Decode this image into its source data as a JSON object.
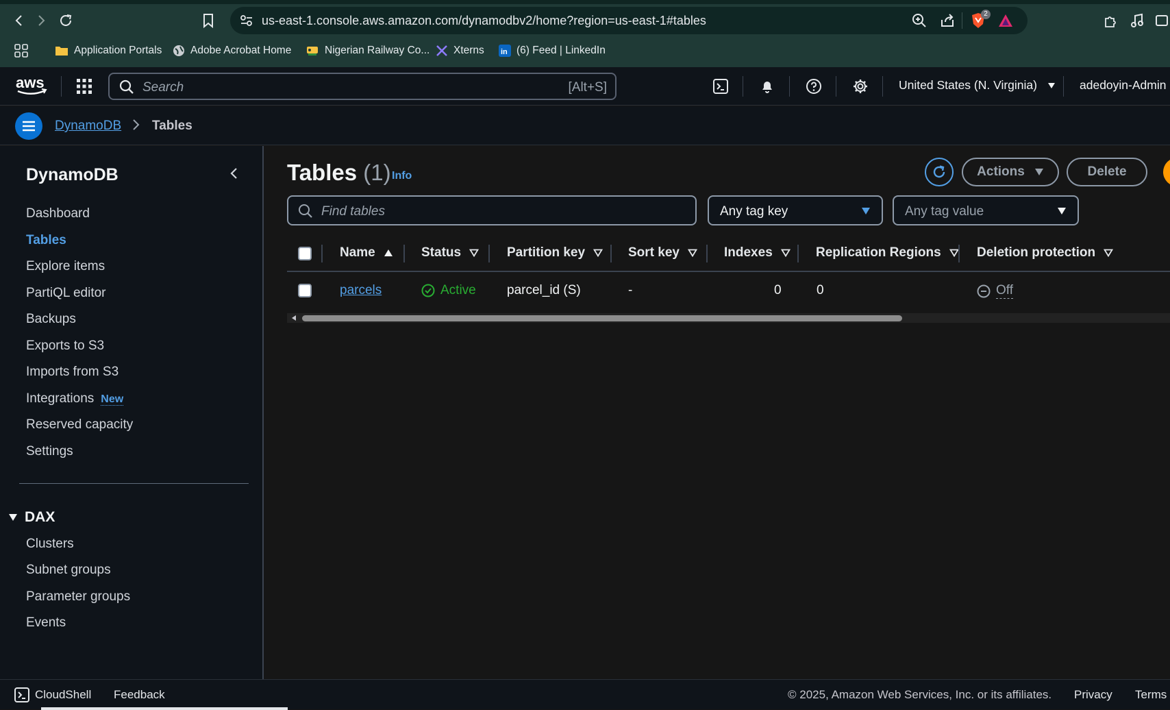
{
  "browser": {
    "url": "us-east-1.console.aws.amazon.com/dynamodbv2/home?region=us-east-1#tables",
    "shield_badge": "2",
    "bookmarks": [
      {
        "label": "Application Portals",
        "icon": "folder-icon"
      },
      {
        "label": "Adobe Acrobat Home",
        "icon": "globe-icon"
      },
      {
        "label": "Nigerian Railway Co...",
        "icon": "railway-logo-icon"
      },
      {
        "label": "Xterns",
        "icon": "x-logo-icon"
      },
      {
        "label": "(6) Feed | LinkedIn",
        "icon": "linkedin-icon"
      }
    ]
  },
  "header": {
    "logo": "aws",
    "search_placeholder": "Search",
    "search_shortcut": "[Alt+S]",
    "region": "United States (N. Virginia)",
    "user": "adedoyin-Admin"
  },
  "breadcrumb": {
    "service": "DynamoDB",
    "current": "Tables"
  },
  "sidebar": {
    "title": "DynamoDB",
    "items": [
      {
        "label": "Dashboard"
      },
      {
        "label": "Tables",
        "active": true
      },
      {
        "label": "Explore items"
      },
      {
        "label": "PartiQL editor"
      },
      {
        "label": "Backups"
      },
      {
        "label": "Exports to S3"
      },
      {
        "label": "Imports from S3"
      },
      {
        "label": "Integrations",
        "badge": "New"
      },
      {
        "label": "Reserved capacity"
      },
      {
        "label": "Settings"
      }
    ],
    "dax": {
      "title": "DAX",
      "items": [
        {
          "label": "Clusters"
        },
        {
          "label": "Subnet groups"
        },
        {
          "label": "Parameter groups"
        },
        {
          "label": "Events"
        }
      ]
    }
  },
  "main": {
    "title": "Tables",
    "count": "(1)",
    "info": "Info",
    "actions_label": "Actions",
    "delete_label": "Delete",
    "find_placeholder": "Find tables",
    "tag_key": "Any tag key",
    "tag_value": "Any tag value",
    "columns": [
      "Name",
      "Status",
      "Partition key",
      "Sort key",
      "Indexes",
      "Replication Regions",
      "Deletion protection"
    ],
    "rows": [
      {
        "name": "parcels",
        "status": "Active",
        "partition_key": "parcel_id (S)",
        "sort_key": "-",
        "indexes": "0",
        "replication_regions": "0",
        "deletion_protection": "Off"
      }
    ]
  },
  "footer": {
    "cloudshell": "CloudShell",
    "feedback": "Feedback",
    "copyright": "© 2025, Amazon Web Services, Inc. or its affiliates.",
    "privacy": "Privacy",
    "terms": "Terms"
  },
  "colors": {
    "accent_link": "#539fe5",
    "active_status": "#29ad32",
    "menu_button": "#0972d3",
    "browser_frame": "#1f3a36"
  }
}
